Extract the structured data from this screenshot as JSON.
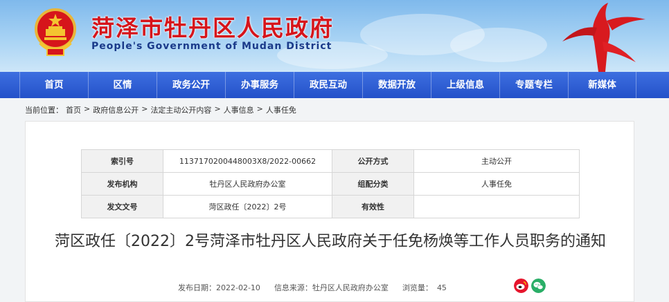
{
  "header": {
    "title": "菏泽市牡丹区人民政府",
    "subtitle": "People's Government of Mudan District"
  },
  "nav": {
    "items": [
      {
        "label": "首页"
      },
      {
        "label": "区情"
      },
      {
        "label": "政务公开"
      },
      {
        "label": "办事服务"
      },
      {
        "label": "政民互动"
      },
      {
        "label": "数据开放"
      },
      {
        "label": "上级信息"
      },
      {
        "label": "专题专栏"
      },
      {
        "label": "新媒体"
      }
    ]
  },
  "breadcrumb": {
    "prefix": "当前位置：",
    "items": [
      "首页",
      "政府信息公开",
      "法定主动公开内容",
      "人事信息",
      "人事任免"
    ],
    "separator": ">"
  },
  "info_table": {
    "rows": [
      {
        "k1": "索引号",
        "v1": "1137170200448003X8/2022-00662",
        "k2": "公开方式",
        "v2": "主动公开"
      },
      {
        "k1": "发布机构",
        "v1": "牡丹区人民政府办公室",
        "k2": "组配分类",
        "v2": "人事任免"
      },
      {
        "k1": "发文文号",
        "v1": "菏区政任〔2022〕2号",
        "k2": "有效性",
        "v2": ""
      }
    ]
  },
  "article": {
    "title": "菏区政任〔2022〕2号菏泽市牡丹区人民政府关于任免杨焕等工作人员职务的通知",
    "date_label": "发布日期：",
    "date": "2022-02-10",
    "source_label": "信息来源：",
    "source": "牡丹区人民政府办公室",
    "views_label": "浏览量：",
    "views": "45"
  },
  "share": {
    "icons": [
      "weibo-icon",
      "wechat-icon"
    ]
  },
  "colors": {
    "title_red": "#d6151b",
    "nav_blue": "#2451c9",
    "subtitle_blue": "#1a3a8a"
  }
}
